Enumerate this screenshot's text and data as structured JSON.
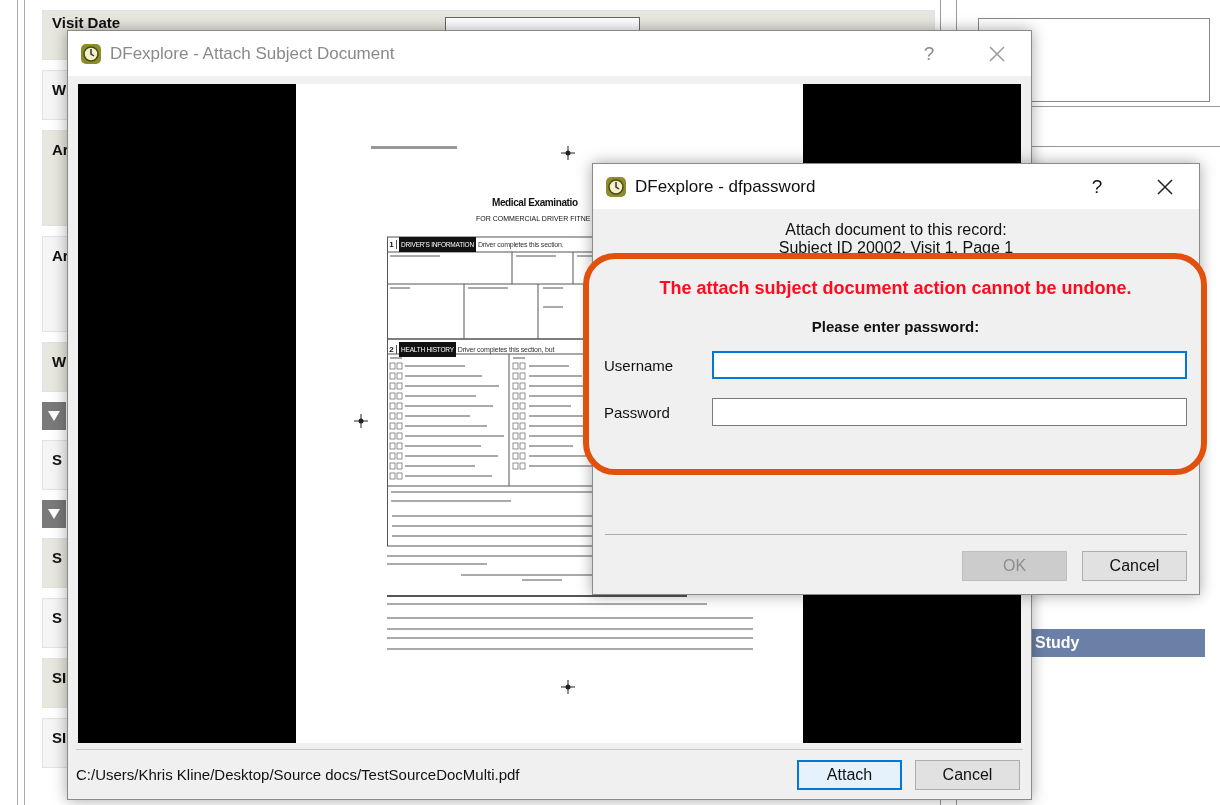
{
  "background": {
    "form_rows": [
      {
        "kind": "date",
        "label": "Visit Date",
        "shaded": true
      },
      {
        "kind": "field",
        "label": "W",
        "shaded": false
      },
      {
        "kind": "multiline",
        "label": "Ar",
        "shaded": true
      },
      {
        "kind": "multiline",
        "label": "Ar",
        "shaded": false
      },
      {
        "kind": "field",
        "label": "W",
        "shaded": true
      },
      {
        "kind": "toggle"
      },
      {
        "kind": "field",
        "label": "S",
        "shaded": false
      },
      {
        "kind": "toggle"
      },
      {
        "kind": "field",
        "label": "S",
        "shaded": true
      },
      {
        "kind": "field",
        "label": "S",
        "shaded": false
      },
      {
        "kind": "field",
        "label": "SI",
        "shaded": true
      },
      {
        "kind": "field",
        "label": "SI",
        "shaded": false
      }
    ],
    "side_panel": {
      "section_bar": "Study"
    }
  },
  "attach_dialog": {
    "title": "DFexplore - Attach Subject Document",
    "active": false,
    "help": "?",
    "document": {
      "title": "Medical Examinatio",
      "subtitle": "FOR COMMERCIAL DRIVER FITNE",
      "sections": [
        {
          "number": "1",
          "heading": "DRIVER'S INFORMATION",
          "note": "Driver completes this section."
        },
        {
          "number": "2",
          "heading": "HEALTH HISTORY",
          "note": "Driver completes this section, but"
        }
      ]
    },
    "file_path": "C:/Users/Khris Kline/Desktop/Source docs/TestSourceDocMulti.pdf",
    "buttons": [
      {
        "label": "Attach",
        "default": true
      },
      {
        "label": "Cancel",
        "default": false
      }
    ]
  },
  "password_dialog": {
    "title": "DFexplore - dfpassword",
    "active": true,
    "help": "?",
    "record_intro": "Attach document to this record:",
    "record": "Subject ID 20002, Visit 1, Page 1",
    "warning": "The attach subject document action cannot be undone.",
    "prompt": "Please enter password:",
    "fields": [
      {
        "label": "Username",
        "focused": true
      },
      {
        "label": "Password",
        "focused": false
      }
    ],
    "buttons": [
      {
        "label": "OK",
        "disabled": true
      },
      {
        "label": "Cancel",
        "disabled": false
      }
    ]
  }
}
